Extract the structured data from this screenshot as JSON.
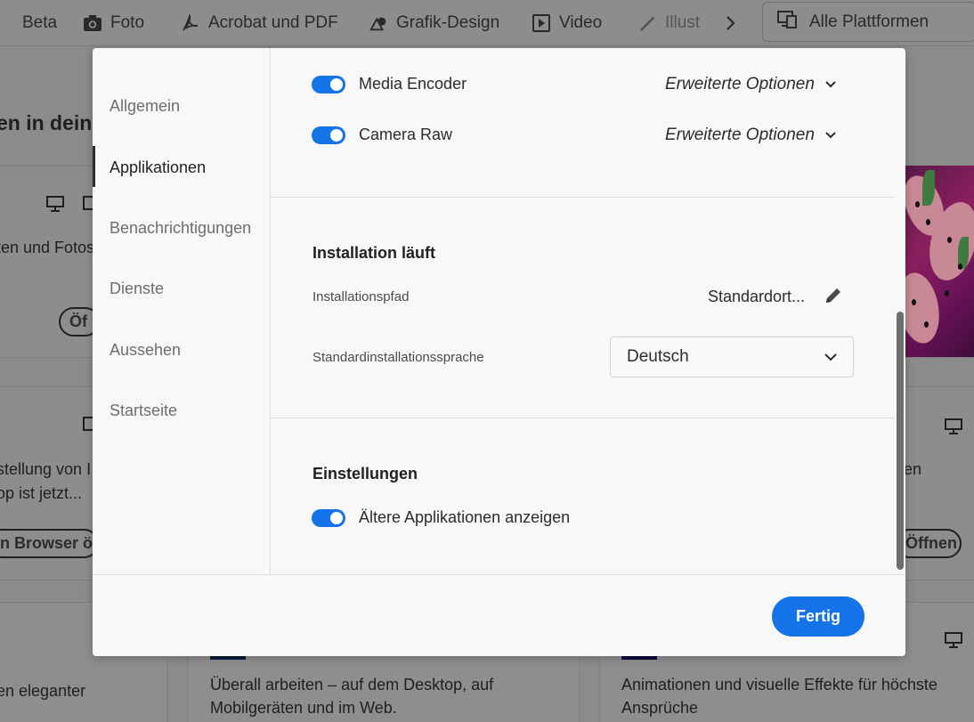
{
  "background": {
    "tabs": [
      {
        "label": "Beta",
        "icon": "beta-icon"
      },
      {
        "label": "Foto",
        "icon": "camera-icon"
      },
      {
        "label": "Acrobat und PDF",
        "icon": "acrobat-icon"
      },
      {
        "label": "Grafik-Design",
        "icon": "graphic-design-icon"
      },
      {
        "label": "Video",
        "icon": "video-icon"
      },
      {
        "label": "Illust",
        "icon": "illustration-icon"
      }
    ],
    "platforms_label": "Alle Plattformen",
    "heading_fragment": "en in deine",
    "card1_text": "ten und Fotos",
    "card1_button": "Öf",
    "card2_line1": "stellung von I",
    "card2_line2": "op ist jetzt...",
    "card2_button": "n Browser öf",
    "card3_line1": "en",
    "card3_button": "Öffnen",
    "card4_text": "en eleganter",
    "card5_line1": "Überall arbeiten – auf dem Desktop, auf",
    "card5_line2": "Mobilgeräten und im Web.",
    "card6_line1": "Animationen und visuelle Effekte für höchste",
    "card6_line2": "Ansprüche"
  },
  "modal": {
    "sidebar": [
      {
        "label": "Allgemein"
      },
      {
        "label": "Applikationen"
      },
      {
        "label": "Benachrichtigungen"
      },
      {
        "label": "Dienste"
      },
      {
        "label": "Aussehen"
      },
      {
        "label": "Startseite"
      }
    ],
    "active_item": "Applikationen",
    "apps": [
      {
        "name": "Media Encoder",
        "enabled": true,
        "advanced_label": "Erweiterte Optionen"
      },
      {
        "name": "Camera Raw",
        "enabled": true,
        "advanced_label": "Erweiterte Optionen"
      }
    ],
    "install": {
      "title": "Installation läuft",
      "path_label": "Installationspfad",
      "path_value": "Standardort...",
      "language_label": "Standardinstallationssprache",
      "language_value": "Deutsch"
    },
    "settings": {
      "title": "Einstellungen",
      "legacy_label": "Ältere Applikationen anzeigen",
      "legacy_enabled": true
    },
    "done_label": "Fertig"
  },
  "colors": {
    "accent": "#1473e6",
    "overlay": "#8b8b8b",
    "modal_bg": "#f8f8f8"
  }
}
